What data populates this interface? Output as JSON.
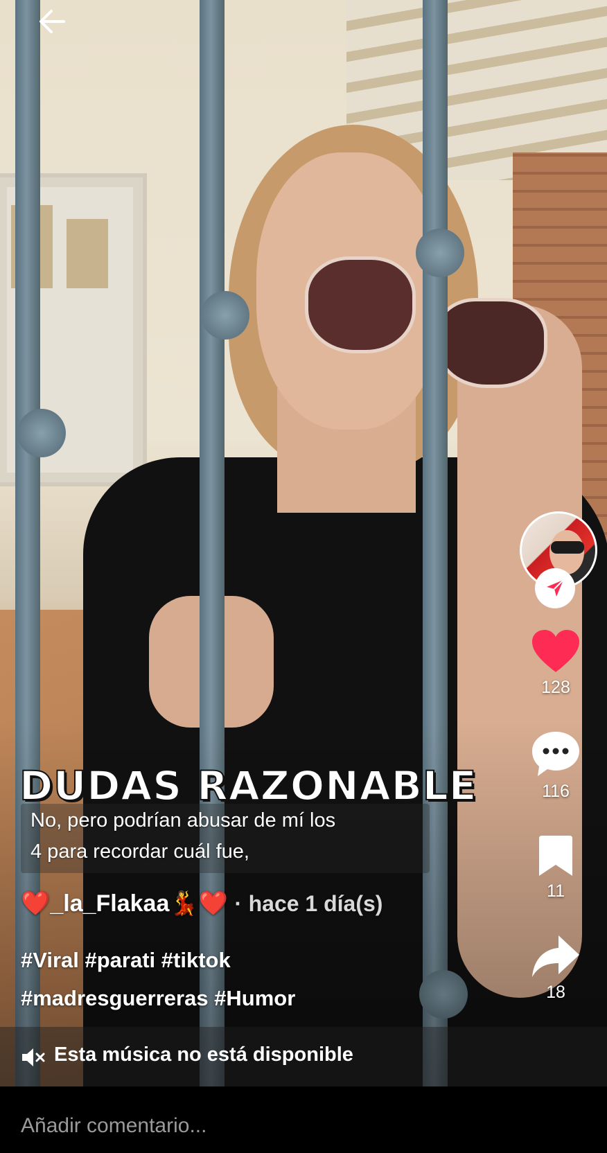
{
  "video": {
    "title_overlay": "DUDAS RAZONABLE",
    "caption_line1": "No, pero podrían abusar de mí los",
    "caption_line2": "4 para recordar cuál fue,"
  },
  "post": {
    "author": "❤️_la_Flakaa💃❤️",
    "time_separator": "·",
    "time": "hace 1 día(s)",
    "hashtags_line1": "#Viral #parati #tiktok",
    "hashtags_line2": "#madresguerreras #Humor"
  },
  "music": {
    "icon": "muted-speaker-icon",
    "text": "Esta música no está disponible"
  },
  "actions": {
    "likes": "128",
    "comments": "116",
    "saves": "11",
    "shares": "18"
  },
  "colors": {
    "like_heart": "#fe2c55",
    "follow_arrow": "#fe2c55",
    "background": "#000000",
    "comment_placeholder": "#9a9a9a"
  },
  "comment_box": {
    "placeholder": "Añadir comentario..."
  }
}
